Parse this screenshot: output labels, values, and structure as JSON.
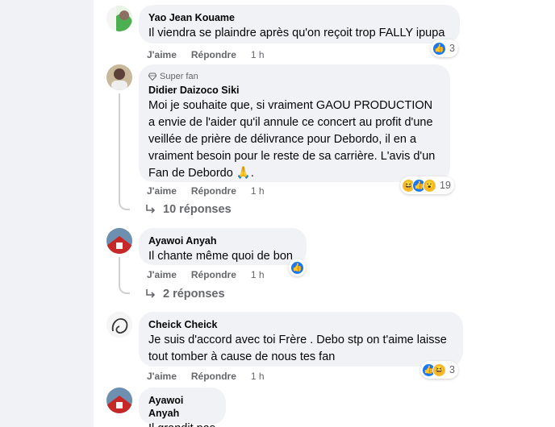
{
  "comments": [
    {
      "author": "Yao Jean Kouame",
      "text": "Il viendra se plaindre après qu'on reçoit trop FALLY ipupa",
      "like_label": "J'aime",
      "reply_label": "Répondre",
      "time": "1 h",
      "reaction_count": "3"
    },
    {
      "badge": "Super fan",
      "author": "Didier Daizoco Siki",
      "text": "Moi je souhaite que, si vraiment GAOU PRODUCTION a envie de l'aider qu'il annule ce concert au profit d'une veillée de prière de délivrance pour Debordo, il en a vraiment besoin pour le reste de sa carrière. L'avis d'un Fan de Debordo 🙏.",
      "like_label": "J'aime",
      "reply_label": "Répondre",
      "time": "1 h",
      "reaction_count": "19",
      "replies_label": "10 réponses"
    },
    {
      "author": "Ayawoi Anyah",
      "text": "Il chante même quoi de bon",
      "like_label": "J'aime",
      "reply_label": "Répondre",
      "time": "1 h",
      "replies_label": "2 réponses"
    },
    {
      "author": "Cheick Cheick",
      "text": "Je suis d'accord avec toi Frère . Debo stp on t'aime laisse tout tomber à cause de nous tes fan",
      "like_label": "J'aime",
      "reply_label": "Répondre",
      "time": "1 h",
      "reaction_count": "3"
    },
    {
      "author": "Ayawoi Anyah",
      "text": "Il grandit pas"
    }
  ],
  "icons": {
    "like": "like-icon",
    "haha": "haha-icon",
    "wow": "wow-icon",
    "diamond": "diamond-icon",
    "reply_arrow": "reply-arrow-icon"
  },
  "colors": {
    "bubble": "#f0f2f5",
    "secondary_text": "#65676b",
    "like_blue": "#1877f2",
    "emoji_yellow": "#f7b928"
  }
}
